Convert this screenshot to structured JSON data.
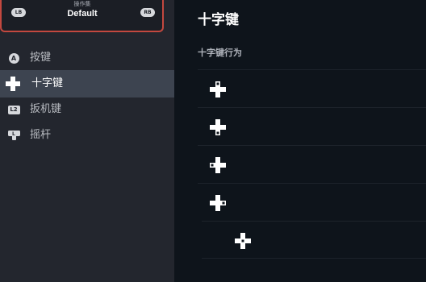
{
  "action_set": {
    "caption": "操作集",
    "name": "Default",
    "lb_label": "LB",
    "rb_label": "RB"
  },
  "sidebar": {
    "items": [
      {
        "icon": "a-button-icon",
        "icon_text": "A",
        "label": "按键",
        "active": false
      },
      {
        "icon": "dpad-icon",
        "label": "十字键",
        "active": true
      },
      {
        "icon": "l2-trigger-icon",
        "icon_text": "L2",
        "label": "扳机键",
        "active": false
      },
      {
        "icon": "left-stick-icon",
        "label": "摇杆",
        "active": false
      }
    ]
  },
  "main": {
    "title": "十字键",
    "section_label": "十字键行为",
    "rows": [
      {
        "icon": "dpad-up-icon",
        "highlight": "up"
      },
      {
        "icon": "dpad-down-icon",
        "highlight": "down"
      },
      {
        "icon": "dpad-left-icon",
        "highlight": "left"
      },
      {
        "icon": "dpad-right-icon",
        "highlight": "right"
      },
      {
        "icon": "dpad-center-icon",
        "highlight": "center"
      }
    ]
  },
  "colors": {
    "sidebar_bg": "#23262e",
    "active_item_bg": "#3d4450",
    "main_bg": "#0e141b",
    "accent_border": "#c3483f"
  }
}
